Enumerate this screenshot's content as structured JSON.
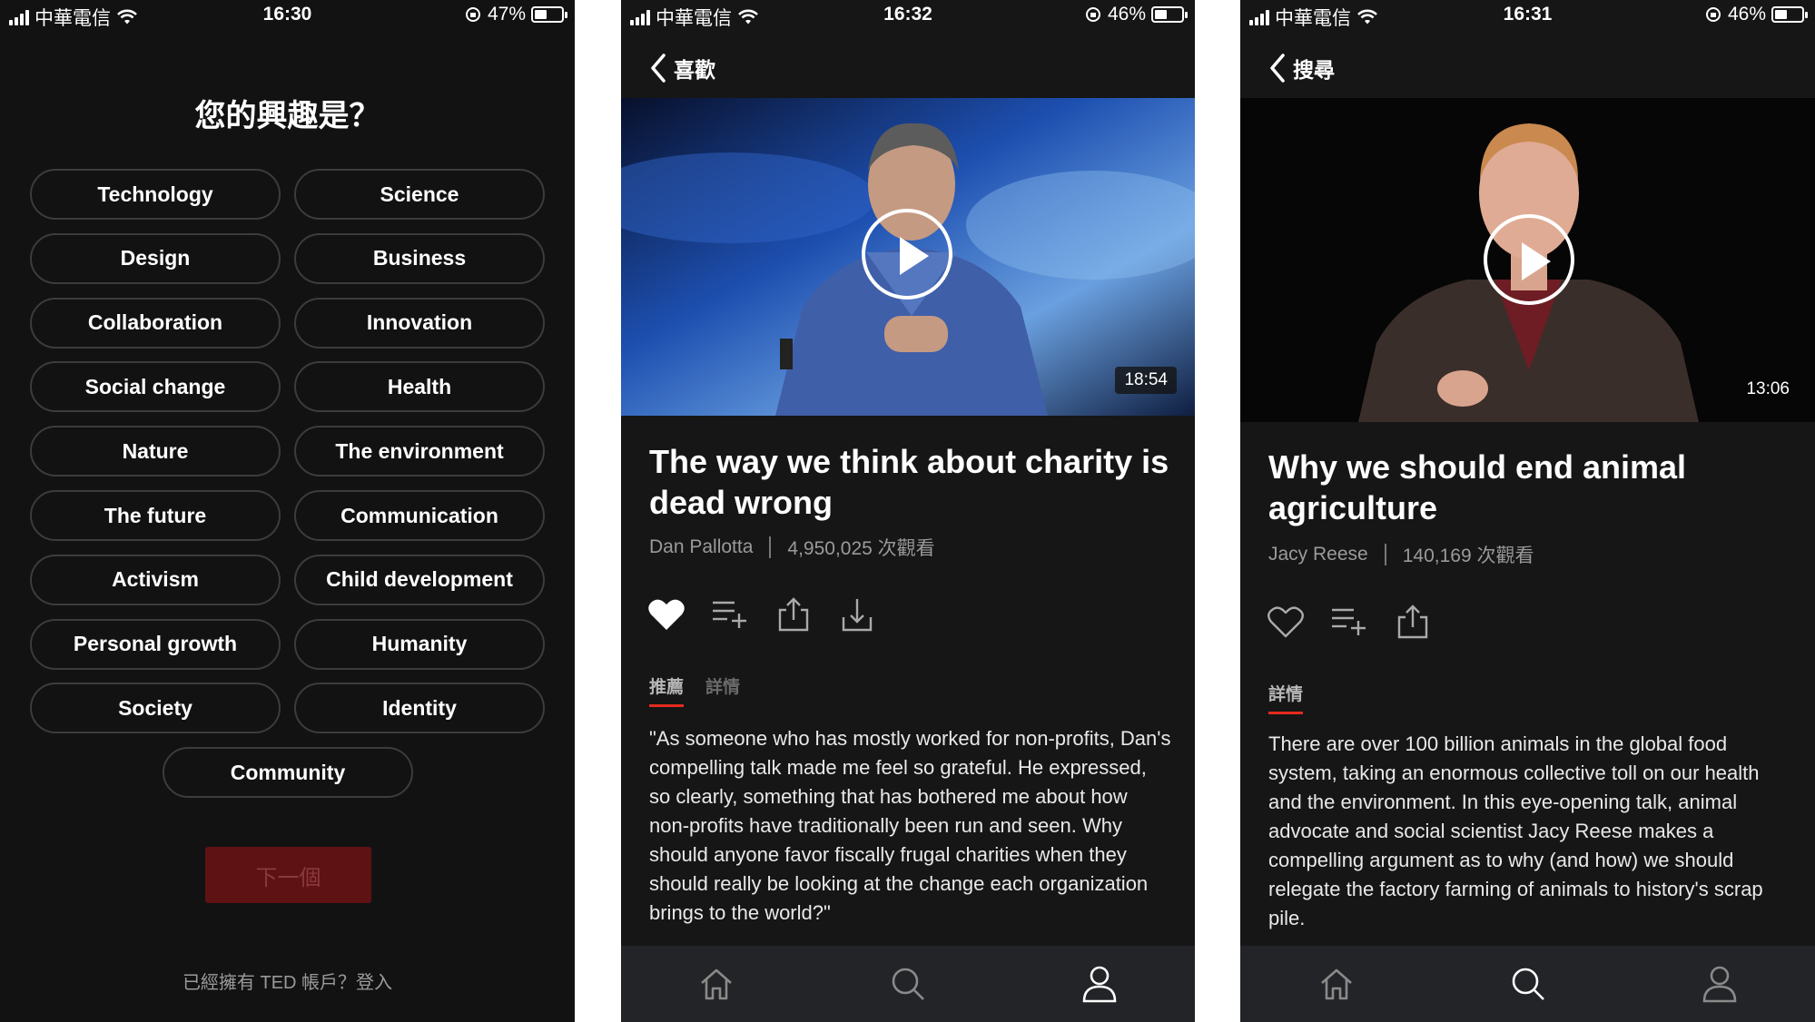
{
  "colors": {
    "accent": "#e62b1e",
    "next_button_bg": "#5e1214",
    "background": "#121212"
  },
  "screen1": {
    "status": {
      "carrier": "中華電信",
      "time": "16:30",
      "battery": "47%",
      "battery_level": 0.47
    },
    "title": "您的興趣是？",
    "interests": [
      "Technology",
      "Science",
      "Design",
      "Business",
      "Collaboration",
      "Innovation",
      "Social change",
      "Health",
      "Nature",
      "The environment",
      "The future",
      "Communication",
      "Activism",
      "Child development",
      "Personal growth",
      "Humanity",
      "Society",
      "Identity",
      "Community"
    ],
    "next_label": "下一個",
    "login_text": "已經擁有 TED 帳戶？登入"
  },
  "screen2": {
    "status": {
      "carrier": "中華電信",
      "time": "16:32",
      "battery": "46%",
      "battery_level": 0.46
    },
    "back_label": "喜歡",
    "duration": "18:54",
    "title": "The way we think about charity is dead wrong",
    "speaker": "Dan Pallotta",
    "views": "4,950,025 次觀看",
    "liked": true,
    "tabs": [
      "推薦",
      "詳情"
    ],
    "description": "\"As someone who has mostly worked for non-profits, Dan's compelling talk made me feel so grateful. He expressed, so clearly, something that has bothered me about how non-profits have traditionally been run and seen. Why should anyone favor fiscally frugal charities when they should really be looking at the change each organization brings to the world?\"",
    "active_tab_icon": "profile-icon"
  },
  "screen3": {
    "status": {
      "carrier": "中華電信",
      "time": "16:31",
      "battery": "46%",
      "battery_level": 0.46
    },
    "back_label": "搜尋",
    "duration": "13:06",
    "title": "Why we should end animal agriculture",
    "speaker": "Jacy Reese",
    "views": "140,169 次觀看",
    "liked": false,
    "tabs": [
      "詳情"
    ],
    "description": "There are over 100 billion animals in the global food system, taking an enormous collective toll on our health and the environment. In this eye-opening talk, animal advocate and social scientist Jacy Reese makes a compelling argument as to why (and how) we should relegate the factory farming of animals to history's scrap pile.",
    "active_tab_icon": "search-icon"
  }
}
